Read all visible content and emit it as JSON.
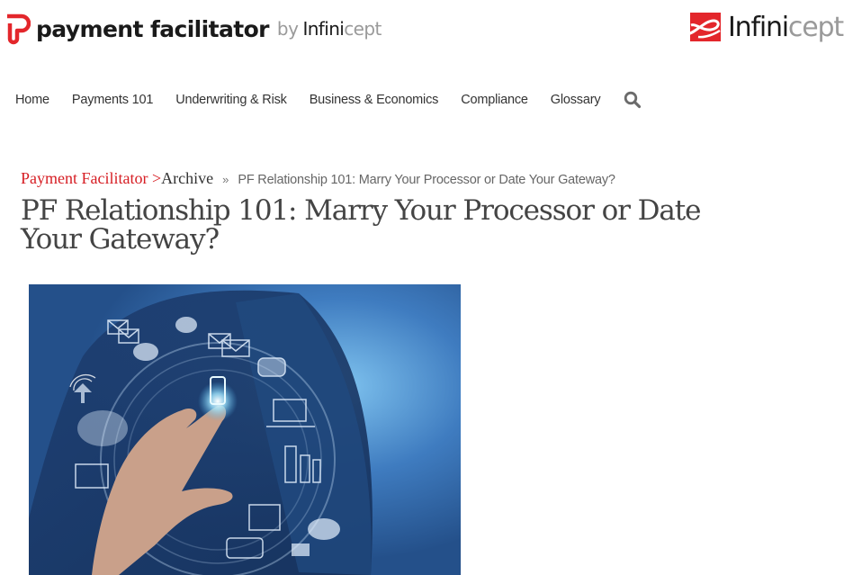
{
  "header": {
    "brand": {
      "name": "payment facilitator",
      "by": "by",
      "partner_bold": "Infini",
      "partner_light": "cept",
      "icon": "pf-logo-icon",
      "color": "#e3262b"
    },
    "partner_logo": {
      "bold": "Infini",
      "light": "cept",
      "icon": "infinicept-logo-icon",
      "color": "#e3262b"
    }
  },
  "nav": {
    "items": [
      {
        "label": "Home"
      },
      {
        "label": "Payments 101"
      },
      {
        "label": "Underwriting & Risk"
      },
      {
        "label": "Business & Economics"
      },
      {
        "label": "Compliance"
      },
      {
        "label": "Glossary"
      }
    ],
    "search_icon": "search-icon"
  },
  "breadcrumb": {
    "root": "Payment Facilitator >",
    "archive": "Archive",
    "separator": "»",
    "current": "PF Relationship 101: Marry Your Processor or Date Your Gateway?"
  },
  "article": {
    "title": "PF Relationship 101: Marry Your Processor or Date Your Gateway?",
    "hero_image": {
      "alt": "Businessman touching a glowing smartphone icon surrounded by floating communication icons (emails, chat bubbles, laptop, servers, wifi)"
    }
  },
  "colors": {
    "accent": "#d61d23",
    "text": "#333333",
    "muted": "#9a9a9a"
  }
}
